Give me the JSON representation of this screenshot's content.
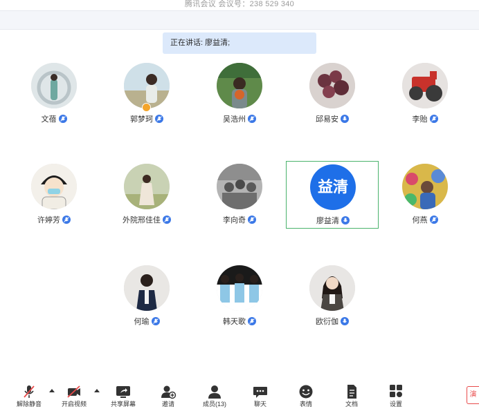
{
  "window": {
    "title": "腾讯会议 会议号：238 529 340"
  },
  "speaking_banner": {
    "text": "正在讲话: 廖益清;"
  },
  "participants": [
    {
      "name": "文蓓"
    },
    {
      "name": "郭梦珂"
    },
    {
      "name": "吴浩州"
    },
    {
      "name": "邱易安"
    },
    {
      "name": "李贻"
    },
    {
      "name": "许婷芳"
    },
    {
      "name": "外院邢佳佳"
    },
    {
      "name": "李向奇"
    },
    {
      "name": "廖益清",
      "avatar_text": "益清"
    },
    {
      "name": "何燕"
    },
    {
      "name": "何瑜"
    },
    {
      "name": "韩天歌"
    },
    {
      "name": "欧衍伽"
    }
  ],
  "toolbar": {
    "unmute": "解除静音",
    "start_video": "开启视频",
    "share_screen": "共享屏幕",
    "invite": "邀请",
    "members": "成员(13)",
    "chat": "聊天",
    "reactions": "表情",
    "docs": "文档",
    "settings": "设置",
    "edge_label": "演"
  },
  "colors": {
    "accent": "#1e6fe8",
    "mic": "#3b78e7",
    "active_border": "#49b26b",
    "banner": "#dce9fb"
  }
}
